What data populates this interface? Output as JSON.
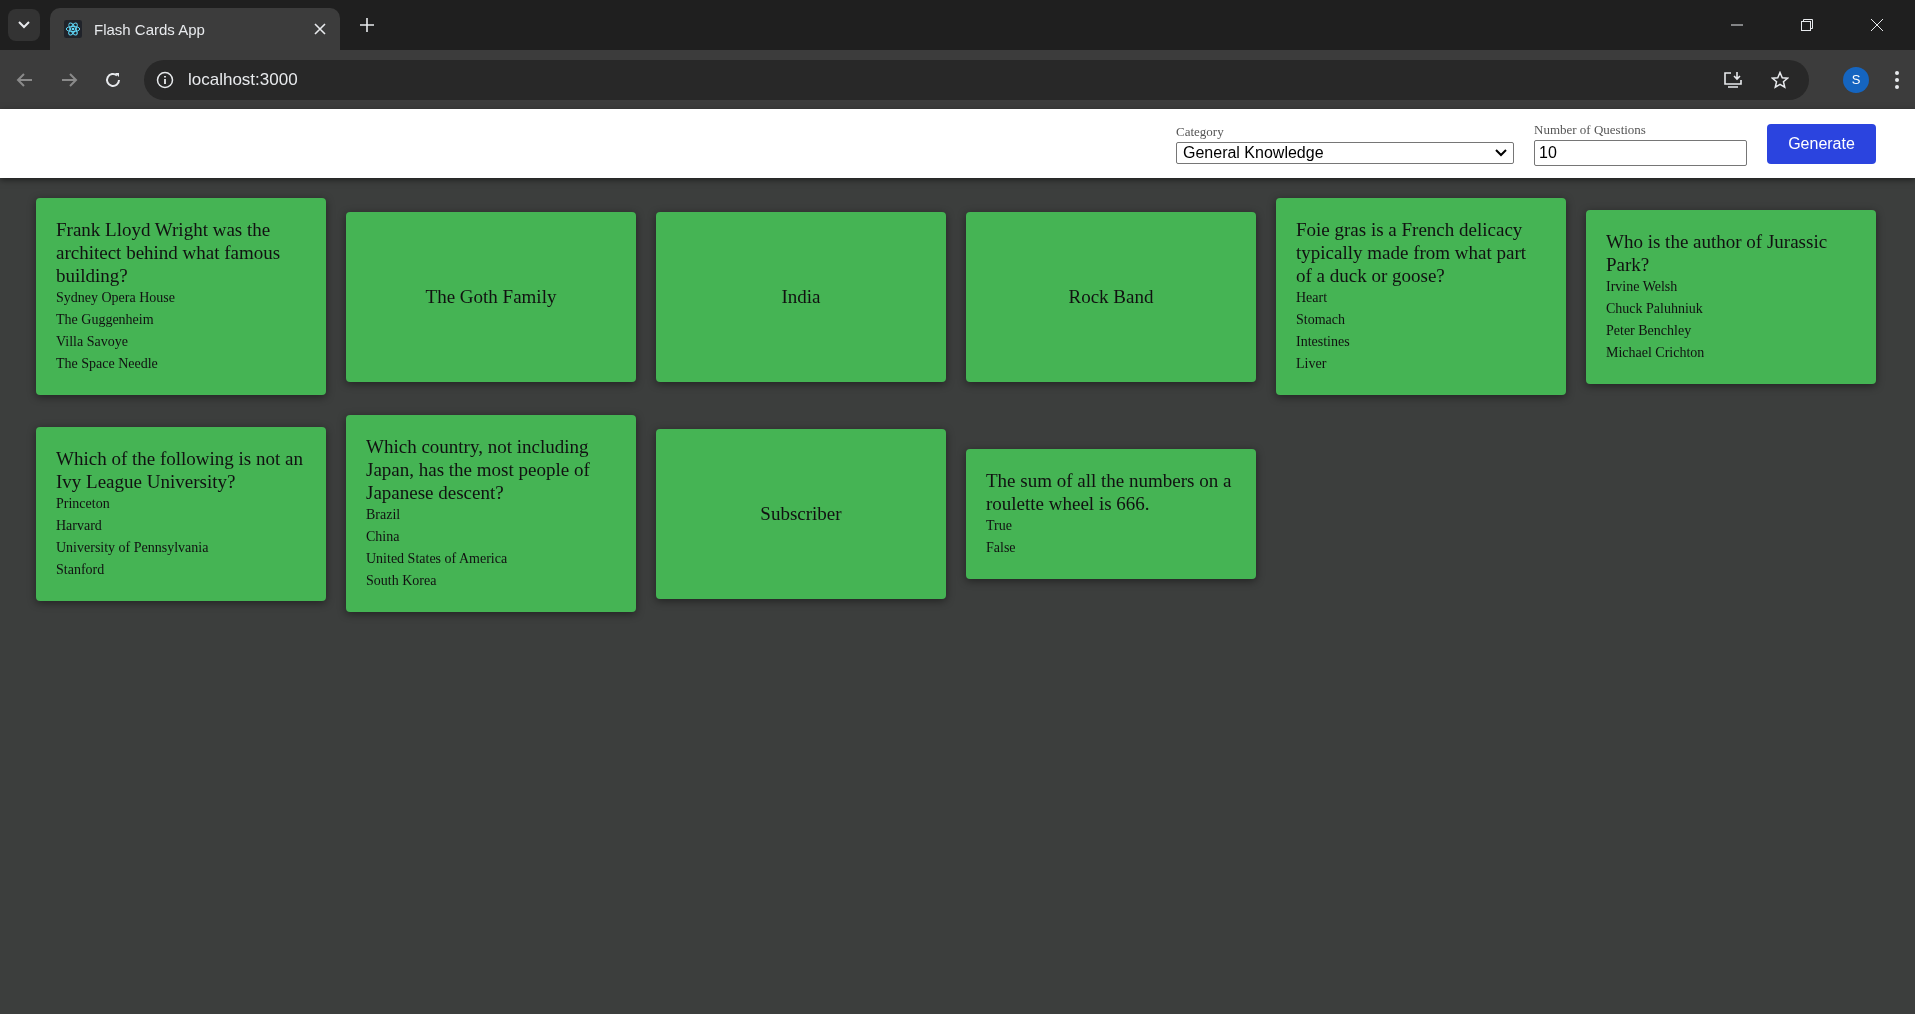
{
  "browser": {
    "tab_title": "Flash Cards App",
    "url": "localhost:3000",
    "profile_initial": "S"
  },
  "header": {
    "category_label": "Category",
    "category_value": "General Knowledge",
    "count_label": "Number of Questions",
    "count_value": "10",
    "generate_button": "Generate"
  },
  "cards": [
    {
      "kind": "question",
      "question": "Frank Lloyd Wright was the architect behind what famous building?",
      "options": [
        "Sydney Opera House",
        "The Guggenheim",
        "Villa Savoye",
        "The Space Needle"
      ]
    },
    {
      "kind": "answer",
      "answer": "The Goth Family"
    },
    {
      "kind": "answer",
      "answer": "India"
    },
    {
      "kind": "answer",
      "answer": "Rock Band"
    },
    {
      "kind": "question",
      "question": "Foie gras is a French delicacy typically made from what part of a duck or goose?",
      "options": [
        "Heart",
        "Stomach",
        "Intestines",
        "Liver"
      ]
    },
    {
      "kind": "question",
      "question": "Who is the author of Jurassic Park?",
      "options": [
        "Irvine Welsh",
        "Chuck Paluhniuk",
        "Peter Benchley",
        "Michael Crichton"
      ]
    },
    {
      "kind": "question",
      "question": "Which of the following is not an Ivy League University?",
      "options": [
        "Princeton",
        "Harvard",
        "University of Pennsylvania",
        "Stanford"
      ]
    },
    {
      "kind": "question",
      "question": "Which country, not including Japan, has the most people of Japanese descent?",
      "options": [
        "Brazil",
        "China",
        "United States of America",
        "South Korea"
      ]
    },
    {
      "kind": "answer",
      "answer": "Subscriber"
    },
    {
      "kind": "question",
      "question": "The sum of all the numbers on a roulette wheel is 666.",
      "options": [
        "True",
        "False"
      ]
    }
  ]
}
